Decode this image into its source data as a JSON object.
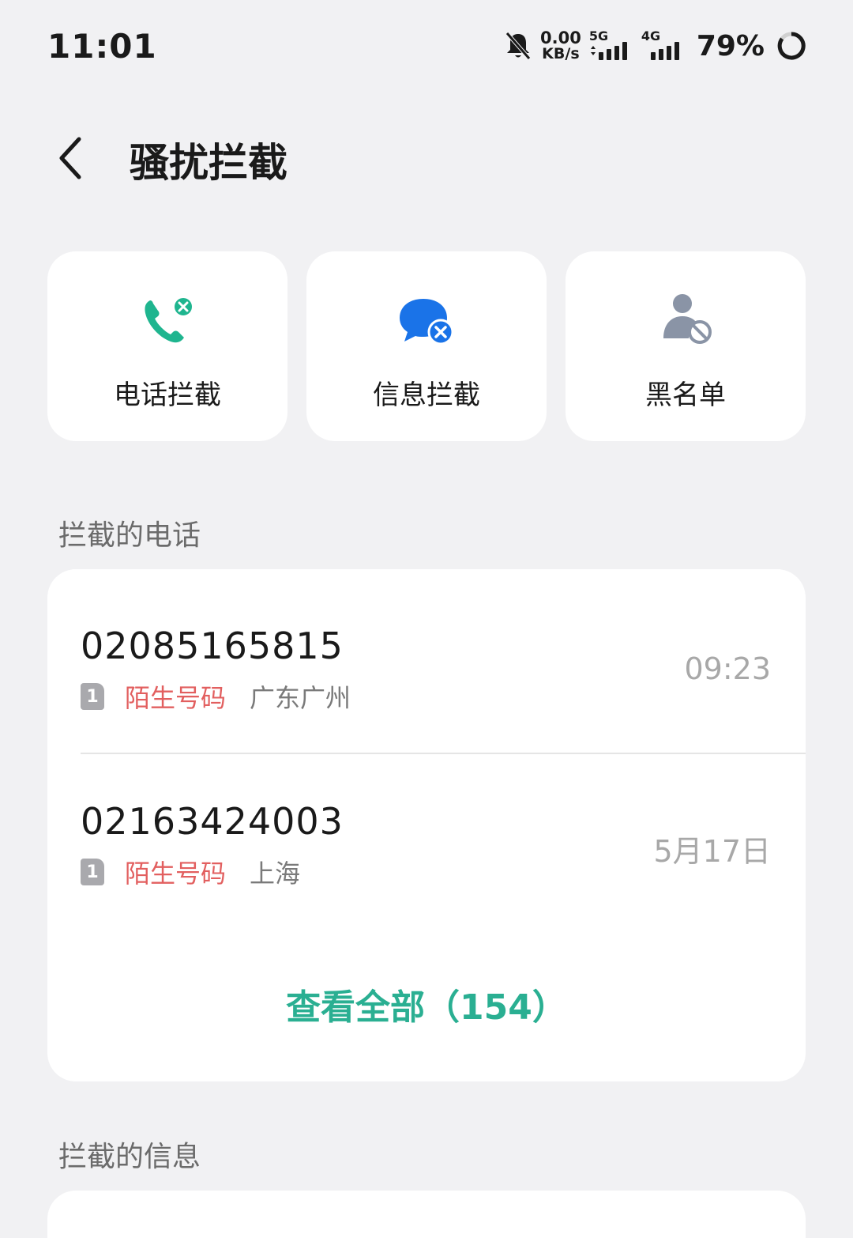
{
  "status_bar": {
    "time": "11:01",
    "net_speed_value": "0.00",
    "net_speed_unit": "KB/s",
    "sim1_type": "5G",
    "sim2_type": "4G",
    "battery": "79%"
  },
  "header": {
    "title": "骚扰拦截"
  },
  "cards": [
    {
      "label": "电话拦截",
      "icon": "phone-blocked-icon",
      "color": "#1fb58f"
    },
    {
      "label": "信息拦截",
      "icon": "message-blocked-icon",
      "color": "#1a73e8"
    },
    {
      "label": "黑名单",
      "icon": "blacklist-user-icon",
      "color": "#8a94a6"
    }
  ],
  "blocked_calls": {
    "heading": "拦截的电话",
    "items": [
      {
        "number": "02085165815",
        "sim": "1",
        "tag": "陌生号码",
        "location": "广东广州",
        "time": "09:23"
      },
      {
        "number": "02163424003",
        "sim": "1",
        "tag": "陌生号码",
        "location": "上海",
        "time": "5月17日"
      }
    ],
    "view_all": "查看全部（154）"
  },
  "blocked_messages": {
    "heading": "拦截的信息"
  },
  "colors": {
    "accent": "#2aaf92",
    "tag_red": "#e25f5f",
    "background": "#f1f1f3"
  }
}
